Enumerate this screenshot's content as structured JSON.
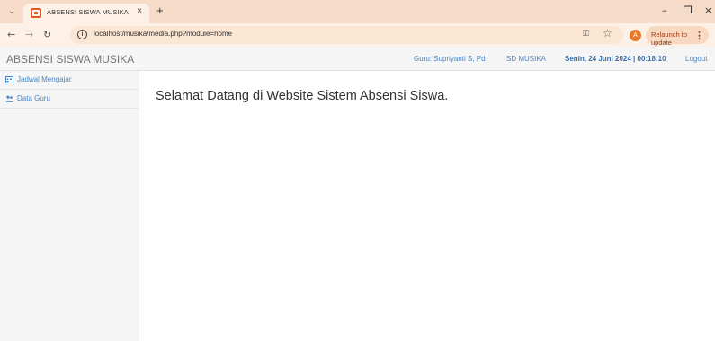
{
  "browser": {
    "tab": {
      "title": "ABSENSI SISWA MUSIKA",
      "close": "×"
    },
    "new_tab": "+",
    "url": "localhost/musika/media.php?module=home",
    "profile_initial": "A",
    "relaunch_label": "Relaunch to update",
    "window_controls": {
      "minimize": "–",
      "maximize": "❐",
      "close": "×"
    }
  },
  "header": {
    "brand": "ABSENSI SISWA MUSIKA",
    "guru": "Guru: Supriyanti S, Pd",
    "school": "SD MUSIKA",
    "datetime": "Senin, 24 Juni 2024 | 00:18:10",
    "logout": "Logout"
  },
  "sidebar": {
    "items": [
      {
        "label": "Jadwal Mengajar",
        "icon": "schedule-icon"
      },
      {
        "label": "Data Guru",
        "icon": "teacher-icon"
      }
    ]
  },
  "main": {
    "welcome": "Selamat Datang di Website Sistem Absensi Siswa."
  },
  "colors": {
    "accent": "#4a86c5",
    "chrome": "#f6dcc8",
    "favicon": "#e0572a"
  }
}
